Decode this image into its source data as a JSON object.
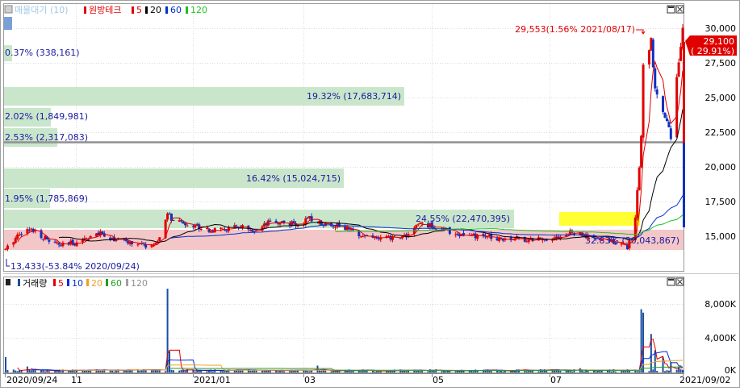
{
  "colors": {
    "up": "#e00000",
    "down": "#1030c0",
    "ma5": "#e00000",
    "ma20": "#000000",
    "ma60": "#0030d0",
    "ma120": "#20c020",
    "current_price": "#e00000",
    "profile_green": "#c9e6cb",
    "profile_red": "#f3c6c8",
    "profile_yellow": "#ffff33",
    "grid": "#d8d8d8",
    "text_blue": "#1a1aa0",
    "volume_bar": "#1a4fa0"
  },
  "price_panel": {
    "legend": {
      "indicator": "매물대기 (10)",
      "stock_name": "원방테크",
      "ma_labels": [
        "5",
        "20",
        "60",
        "120"
      ]
    },
    "yaxis_ticks": [
      "30,000",
      "27,500",
      "25,000",
      "22,500",
      "20,000",
      "17,500",
      "15,000"
    ],
    "current_price": "29,100",
    "current_change": "( 29.91%)",
    "max_annotation": "29,553(1.56% 2021/08/17)",
    "min_annotation": "13,433(-53.84% 2020/09/24)",
    "volume_profile_labels": [
      "0.37% (338,161)",
      "19.32% (17,683,714)",
      "2.02% (1,849,981)",
      "2.53% (2,317,083)",
      "16.42% (15,024,715)",
      "1.95% (1,785,869)",
      "24.55% (22,470,395)",
      "32.83% (30,043,867)"
    ]
  },
  "volume_panel": {
    "legend": {
      "indicator": "거래량",
      "ma_labels": [
        "5",
        "10",
        "20",
        "60",
        "120"
      ]
    },
    "yaxis_ticks": [
      "8,000K",
      "4,000K",
      "0K"
    ]
  },
  "xaxis_labels": [
    "2020/09/24",
    "11",
    "2021/01",
    "03",
    "05",
    "07",
    "2021/09/02"
  ],
  "chart_data": {
    "type": "candlestick",
    "x_start": "2020/09/24",
    "x_end": "2021/09/02",
    "price_ylim": [
      13000,
      31000
    ],
    "volume_ylim_thousands": [
      0,
      10000
    ],
    "price_path": [
      [
        "2020/09/24",
        14400
      ],
      [
        "2020/10/01",
        15600
      ],
      [
        "2020/10/08",
        15800
      ],
      [
        "2020/10/15",
        15100
      ],
      [
        "2020/10/22",
        14700
      ],
      [
        "2020/10/29",
        14900
      ],
      [
        "2020/11/05",
        15300
      ],
      [
        "2020/11/12",
        15500
      ],
      [
        "2020/11/19",
        15100
      ],
      [
        "2020/11/26",
        14900
      ],
      [
        "2020/12/03",
        14700
      ],
      [
        "2020/12/10",
        14800
      ],
      [
        "2020/12/15",
        16900
      ],
      [
        "2020/12/18",
        16300
      ],
      [
        "2020/12/24",
        16200
      ],
      [
        "2020/12/31",
        16000
      ],
      [
        "2021/01/07",
        15700
      ],
      [
        "2021/01/14",
        15800
      ],
      [
        "2021/01/21",
        16000
      ],
      [
        "2021/01/28",
        15500
      ],
      [
        "2021/02/04",
        16200
      ],
      [
        "2021/02/11",
        16300
      ],
      [
        "2021/02/18",
        16100
      ],
      [
        "2021/02/25",
        16500
      ],
      [
        "2021/03/04",
        16200
      ],
      [
        "2021/03/11",
        16100
      ],
      [
        "2021/03/18",
        15700
      ],
      [
        "2021/03/25",
        15400
      ],
      [
        "2021/04/01",
        15200
      ],
      [
        "2021/04/08",
        15200
      ],
      [
        "2021/04/15",
        15400
      ],
      [
        "2021/04/22",
        16200
      ],
      [
        "2021/04/29",
        16000
      ],
      [
        "2021/05/06",
        15700
      ],
      [
        "2021/05/13",
        15400
      ],
      [
        "2021/05/20",
        15300
      ],
      [
        "2021/05/27",
        15300
      ],
      [
        "2021/06/03",
        15200
      ],
      [
        "2021/06/10",
        15200
      ],
      [
        "2021/06/17",
        15100
      ],
      [
        "2021/06/24",
        15200
      ],
      [
        "2021/07/01",
        15300
      ],
      [
        "2021/07/08",
        15600
      ],
      [
        "2021/07/15",
        15300
      ],
      [
        "2021/07/22",
        15100
      ],
      [
        "2021/07/29",
        15000
      ],
      [
        "2021/08/02",
        14800
      ],
      [
        "2021/08/05",
        14600
      ],
      [
        "2021/08/09",
        16600
      ],
      [
        "2021/08/12",
        22000
      ],
      [
        "2021/08/13",
        27000
      ],
      [
        "2021/08/17",
        28500
      ],
      [
        "2021/08/19",
        25000
      ],
      [
        "2021/08/23",
        24000
      ],
      [
        "2021/08/25",
        23200
      ],
      [
        "2021/08/27",
        22000
      ],
      [
        "2021/08/31",
        27300
      ],
      [
        "2021/09/02",
        29100
      ]
    ],
    "volume_spikes_thousands": [
      [
        "2020/09/24",
        1800
      ],
      [
        "2020/10/05",
        700
      ],
      [
        "2020/12/15",
        9800
      ],
      [
        "2020/12/16",
        2500
      ],
      [
        "2021/01/10",
        600
      ],
      [
        "2021/03/01",
        800
      ],
      [
        "2021/07/12",
        500
      ],
      [
        "2021/08/12",
        7400
      ],
      [
        "2021/08/13",
        7000
      ],
      [
        "2021/08/17",
        4500
      ],
      [
        "2021/08/19",
        2600
      ],
      [
        "2021/08/23",
        1800
      ],
      [
        "2021/08/27",
        1200
      ],
      [
        "2021/08/31",
        600
      ]
    ]
  }
}
